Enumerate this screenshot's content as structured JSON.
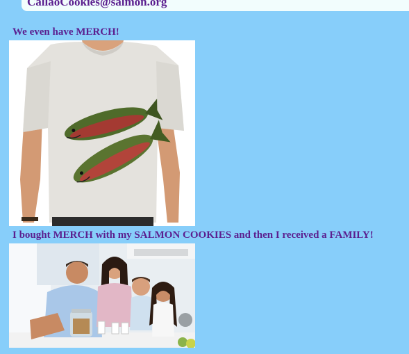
{
  "header": {
    "email_text": "CallaoCookies@salmon.org"
  },
  "content": {
    "merch_caption": "We even have MERCH!",
    "family_caption": "I bought MERCH with my SALMON COOKIES and then I received a FAMILY!"
  },
  "images": {
    "merch": "t-shirt-with-two-salmon-print",
    "family": "smiling-family-in-kitchen-with-cookie-jar"
  },
  "colors": {
    "page_background": "#87cefa",
    "text_purple": "#5b1f8f",
    "card_background": "#f2fdfd"
  }
}
